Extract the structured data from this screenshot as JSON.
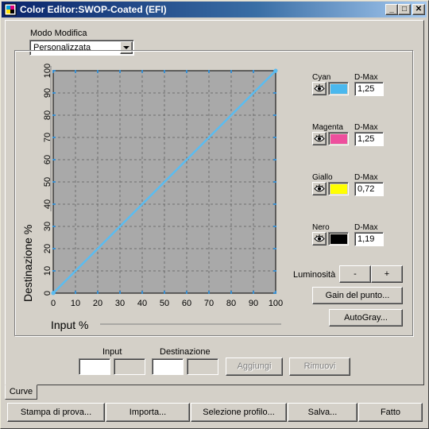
{
  "window": {
    "title": "Color Editor:SWOP-Coated (EFI)",
    "controls": {
      "minimize": "_",
      "maximize": "□",
      "close": "✕"
    }
  },
  "mode": {
    "label": "Modo Modifica",
    "selected": "Personalizzata"
  },
  "chart_data": {
    "type": "line",
    "xlabel": "Input %",
    "ylabel": "Destinazione %",
    "xlim": [
      0,
      100
    ],
    "ylim": [
      0,
      100
    ],
    "x_ticks": [
      "0",
      "10",
      "20",
      "30",
      "40",
      "50",
      "60",
      "70",
      "80",
      "90",
      "100"
    ],
    "y_ticks": [
      "0",
      "10",
      "20",
      "30",
      "40",
      "50",
      "60",
      "70",
      "80",
      "90",
      "100"
    ],
    "grid": true,
    "series": [
      {
        "x": [
          0,
          100
        ],
        "y": [
          0,
          100
        ],
        "color": "#5bbcf0"
      }
    ]
  },
  "inks": [
    {
      "name": "Cyan",
      "dmax_label": "D-Max",
      "dmax": "1,25",
      "color": "#4ab8ee"
    },
    {
      "name": "Magenta",
      "dmax_label": "D-Max",
      "dmax": "1,25",
      "color": "#ee4f9d"
    },
    {
      "name": "Giallo",
      "dmax_label": "D-Max",
      "dmax": "0,72",
      "color": "#ffff00"
    },
    {
      "name": "Nero",
      "dmax_label": "D-Max",
      "dmax": "1,19",
      "color": "#000000"
    }
  ],
  "luminosity": {
    "label": "Luminosità",
    "minus": "-",
    "plus": "+"
  },
  "buttons": {
    "gain": "Gain del punto...",
    "autogray": "AutoGray...",
    "add": "Aggiungi",
    "remove": "Rimuovi"
  },
  "point_entry": {
    "input_label": "Input",
    "dest_label": "Destinazione"
  },
  "tabs": [
    {
      "label": "Curve"
    }
  ],
  "footer": {
    "proof": "Stampa di prova...",
    "import": "Importa...",
    "profile": "Selezione profilo...",
    "save": "Salva...",
    "done": "Fatto"
  }
}
